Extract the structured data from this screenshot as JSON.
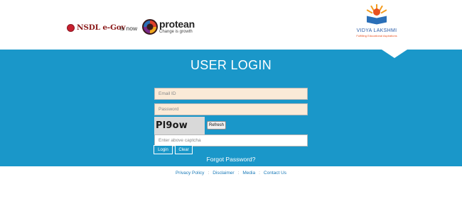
{
  "header": {
    "nsdl_logo_text": "NSDL e-Gov",
    "is_now_text": "is now",
    "protean_name": "protean",
    "protean_tagline": "Change is growth",
    "vidya_name": "VIDYA LAKSHMI",
    "vidya_tagline": "Fulfilling Educational Aspirations"
  },
  "login": {
    "title": "USER LOGIN",
    "email_placeholder": "Email ID",
    "password_placeholder": "Password",
    "captcha_text": "Pl9ow",
    "refresh_label": "Refresh",
    "captcha_input_placeholder": "Enter above captcha",
    "login_label": "Login",
    "clear_label": "Clear",
    "forgot_label": "Forgot Password?"
  },
  "footer": {
    "links": [
      "Privacy Policy",
      "Disclaimer",
      "Media",
      "Contact Us"
    ],
    "separator": ":"
  },
  "colors": {
    "band": "#1a97c9",
    "input_fill": "#fbead7"
  }
}
